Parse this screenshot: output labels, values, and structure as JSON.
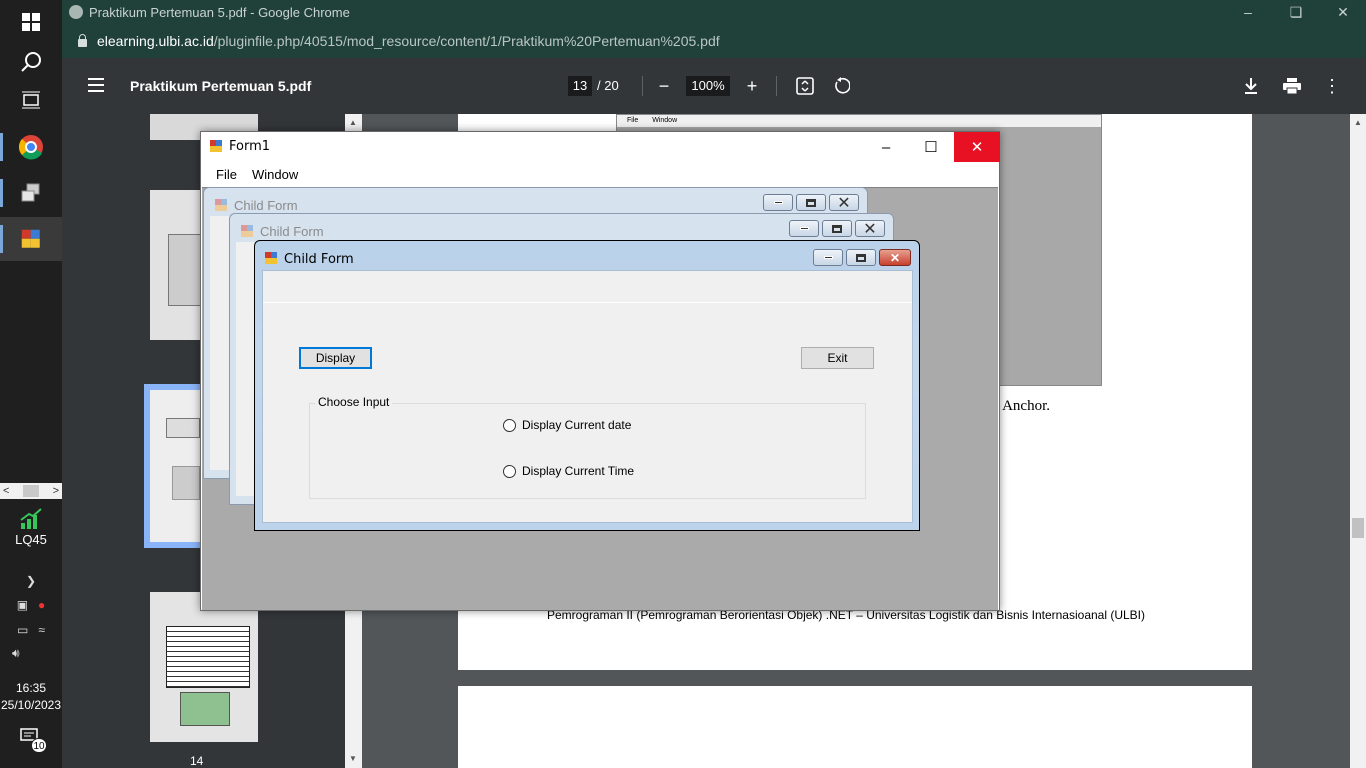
{
  "taskbar": {
    "stock_label": "LQ45",
    "time": "16:35",
    "date": "25/10/2023",
    "notification_count": "10"
  },
  "chrome": {
    "window_title": "Praktikum Pertemuan 5.pdf - Google Chrome",
    "url_domain": "elearning.ulbi.ac.id",
    "url_path": "/pluginfile.php/40515/mod_resource/content/1/Praktikum%20Pertemuan%205.pdf"
  },
  "pdf": {
    "title": "Praktikum Pertemuan 5.pdf",
    "current_page": "13",
    "total_pages": "/ 20",
    "zoom": "100%",
    "thumb_page_number": "14",
    "embedded_menu": "File Window",
    "text_fragment": "an Anchor.",
    "footer": "Pemrograman II (Pemrograman Berorientasi Objek) .NET – Universitas Logistik dan Bisnis Internasioanal (ULBI)"
  },
  "form1": {
    "title": "Form1",
    "menu": [
      "File",
      "Window"
    ]
  },
  "child_forms": {
    "inactive_title_1": "Child Form",
    "inactive_title_2": "Child Form",
    "active_title": "Child Form",
    "display_button": "Display",
    "exit_button": "Exit",
    "group_label": "Choose Input",
    "radio_date": "Display Current date",
    "radio_time": "Display Current Time"
  }
}
